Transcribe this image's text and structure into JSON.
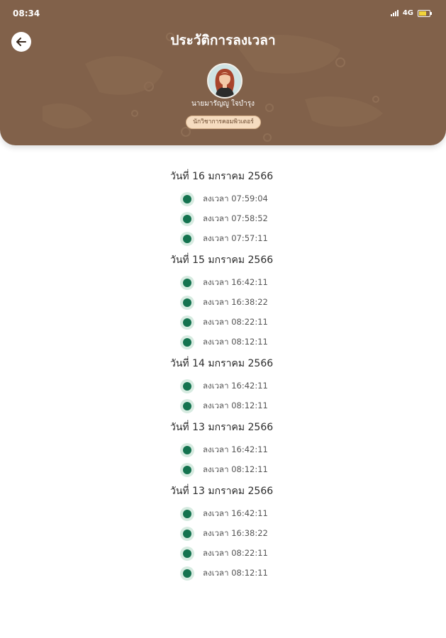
{
  "status_bar": {
    "time": "08:34",
    "network": "4G"
  },
  "header": {
    "title": "ประวัติการลงเวลา",
    "user_name": "นายมารัญญู ใจบำรุง",
    "role": "นักวิชาการคอมพิวเตอร์"
  },
  "colors": {
    "header": "#81614a",
    "dot": "#14734f",
    "dot_ring": "#d7ebe1",
    "badge": "#f6dcc0"
  },
  "history": [
    {
      "date": "วันที่ 16 มกราคม 2566",
      "entries": [
        "ลงเวลา 07:59:04",
        "ลงเวลา 07:58:52",
        "ลงเวลา 07:57:11"
      ]
    },
    {
      "date": "วันที่ 15 มกราคม 2566",
      "entries": [
        "ลงเวลา 16:42:11",
        "ลงเวลา 16:38:22",
        "ลงเวลา 08:22:11",
        "ลงเวลา 08:12:11"
      ]
    },
    {
      "date": "วันที่ 14 มกราคม 2566",
      "entries": [
        "ลงเวลา 16:42:11",
        "ลงเวลา 08:12:11"
      ]
    },
    {
      "date": "วันที่ 13 มกราคม 2566",
      "entries": [
        "ลงเวลา 16:42:11",
        "ลงเวลา 08:12:11"
      ]
    },
    {
      "date": "วันที่ 13 มกราคม 2566",
      "entries": [
        "ลงเวลา 16:42:11",
        "ลงเวลา 16:38:22",
        "ลงเวลา 08:22:11",
        "ลงเวลา 08:12:11"
      ]
    }
  ]
}
